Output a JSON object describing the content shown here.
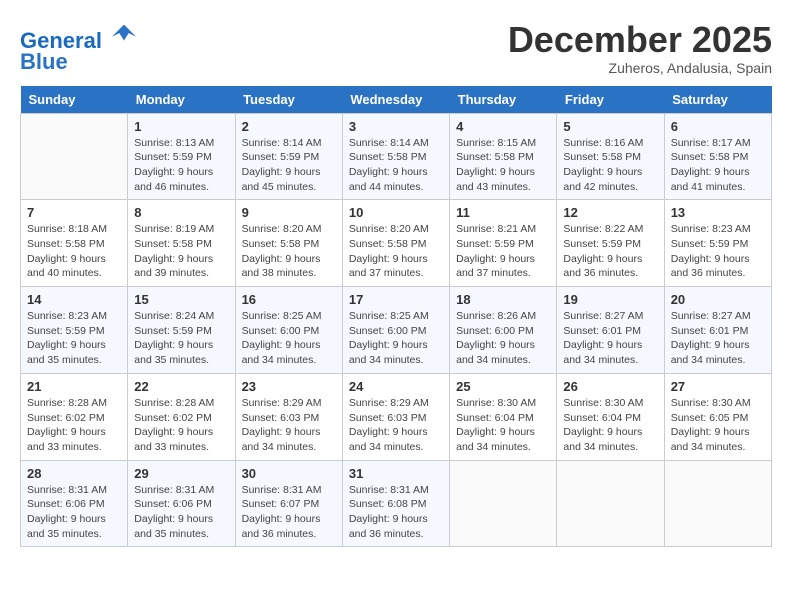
{
  "header": {
    "logo_line1": "General",
    "logo_line2": "Blue",
    "month": "December 2025",
    "location": "Zuheros, Andalusia, Spain"
  },
  "weekdays": [
    "Sunday",
    "Monday",
    "Tuesday",
    "Wednesday",
    "Thursday",
    "Friday",
    "Saturday"
  ],
  "weeks": [
    [
      {
        "day": "",
        "info": ""
      },
      {
        "day": "1",
        "info": "Sunrise: 8:13 AM\nSunset: 5:59 PM\nDaylight: 9 hours\nand 46 minutes."
      },
      {
        "day": "2",
        "info": "Sunrise: 8:14 AM\nSunset: 5:59 PM\nDaylight: 9 hours\nand 45 minutes."
      },
      {
        "day": "3",
        "info": "Sunrise: 8:14 AM\nSunset: 5:58 PM\nDaylight: 9 hours\nand 44 minutes."
      },
      {
        "day": "4",
        "info": "Sunrise: 8:15 AM\nSunset: 5:58 PM\nDaylight: 9 hours\nand 43 minutes."
      },
      {
        "day": "5",
        "info": "Sunrise: 8:16 AM\nSunset: 5:58 PM\nDaylight: 9 hours\nand 42 minutes."
      },
      {
        "day": "6",
        "info": "Sunrise: 8:17 AM\nSunset: 5:58 PM\nDaylight: 9 hours\nand 41 minutes."
      }
    ],
    [
      {
        "day": "7",
        "info": "Sunrise: 8:18 AM\nSunset: 5:58 PM\nDaylight: 9 hours\nand 40 minutes."
      },
      {
        "day": "8",
        "info": "Sunrise: 8:19 AM\nSunset: 5:58 PM\nDaylight: 9 hours\nand 39 minutes."
      },
      {
        "day": "9",
        "info": "Sunrise: 8:20 AM\nSunset: 5:58 PM\nDaylight: 9 hours\nand 38 minutes."
      },
      {
        "day": "10",
        "info": "Sunrise: 8:20 AM\nSunset: 5:58 PM\nDaylight: 9 hours\nand 37 minutes."
      },
      {
        "day": "11",
        "info": "Sunrise: 8:21 AM\nSunset: 5:59 PM\nDaylight: 9 hours\nand 37 minutes."
      },
      {
        "day": "12",
        "info": "Sunrise: 8:22 AM\nSunset: 5:59 PM\nDaylight: 9 hours\nand 36 minutes."
      },
      {
        "day": "13",
        "info": "Sunrise: 8:23 AM\nSunset: 5:59 PM\nDaylight: 9 hours\nand 36 minutes."
      }
    ],
    [
      {
        "day": "14",
        "info": "Sunrise: 8:23 AM\nSunset: 5:59 PM\nDaylight: 9 hours\nand 35 minutes."
      },
      {
        "day": "15",
        "info": "Sunrise: 8:24 AM\nSunset: 5:59 PM\nDaylight: 9 hours\nand 35 minutes."
      },
      {
        "day": "16",
        "info": "Sunrise: 8:25 AM\nSunset: 6:00 PM\nDaylight: 9 hours\nand 34 minutes."
      },
      {
        "day": "17",
        "info": "Sunrise: 8:25 AM\nSunset: 6:00 PM\nDaylight: 9 hours\nand 34 minutes."
      },
      {
        "day": "18",
        "info": "Sunrise: 8:26 AM\nSunset: 6:00 PM\nDaylight: 9 hours\nand 34 minutes."
      },
      {
        "day": "19",
        "info": "Sunrise: 8:27 AM\nSunset: 6:01 PM\nDaylight: 9 hours\nand 34 minutes."
      },
      {
        "day": "20",
        "info": "Sunrise: 8:27 AM\nSunset: 6:01 PM\nDaylight: 9 hours\nand 34 minutes."
      }
    ],
    [
      {
        "day": "21",
        "info": "Sunrise: 8:28 AM\nSunset: 6:02 PM\nDaylight: 9 hours\nand 33 minutes."
      },
      {
        "day": "22",
        "info": "Sunrise: 8:28 AM\nSunset: 6:02 PM\nDaylight: 9 hours\nand 33 minutes."
      },
      {
        "day": "23",
        "info": "Sunrise: 8:29 AM\nSunset: 6:03 PM\nDaylight: 9 hours\nand 34 minutes."
      },
      {
        "day": "24",
        "info": "Sunrise: 8:29 AM\nSunset: 6:03 PM\nDaylight: 9 hours\nand 34 minutes."
      },
      {
        "day": "25",
        "info": "Sunrise: 8:30 AM\nSunset: 6:04 PM\nDaylight: 9 hours\nand 34 minutes."
      },
      {
        "day": "26",
        "info": "Sunrise: 8:30 AM\nSunset: 6:04 PM\nDaylight: 9 hours\nand 34 minutes."
      },
      {
        "day": "27",
        "info": "Sunrise: 8:30 AM\nSunset: 6:05 PM\nDaylight: 9 hours\nand 34 minutes."
      }
    ],
    [
      {
        "day": "28",
        "info": "Sunrise: 8:31 AM\nSunset: 6:06 PM\nDaylight: 9 hours\nand 35 minutes."
      },
      {
        "day": "29",
        "info": "Sunrise: 8:31 AM\nSunset: 6:06 PM\nDaylight: 9 hours\nand 35 minutes."
      },
      {
        "day": "30",
        "info": "Sunrise: 8:31 AM\nSunset: 6:07 PM\nDaylight: 9 hours\nand 36 minutes."
      },
      {
        "day": "31",
        "info": "Sunrise: 8:31 AM\nSunset: 6:08 PM\nDaylight: 9 hours\nand 36 minutes."
      },
      {
        "day": "",
        "info": ""
      },
      {
        "day": "",
        "info": ""
      },
      {
        "day": "",
        "info": ""
      }
    ]
  ]
}
